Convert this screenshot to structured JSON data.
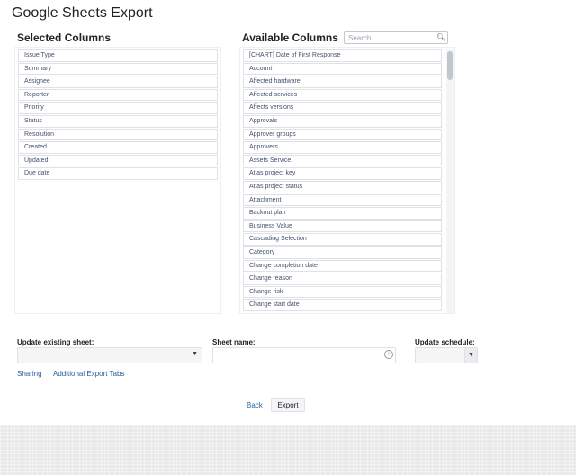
{
  "page": {
    "title": "Google Sheets Export"
  },
  "selected": {
    "heading": "Selected Columns",
    "items": [
      "Issue Type",
      "Summary",
      "Assignee",
      "Reporter",
      "Priority",
      "Status",
      "Resolution",
      "Created",
      "Updated",
      "Due date"
    ]
  },
  "available": {
    "heading": "Available Columns",
    "search_placeholder": "Search",
    "items": [
      "[CHART] Date of First Response",
      "Account",
      "Affected hardware",
      "Affected services",
      "Affects versions",
      "Approvals",
      "Approver groups",
      "Approvers",
      "Assets Service",
      "Atlas project key",
      "Atlas project status",
      "Attachment",
      "Backout plan",
      "Business Value",
      "Cascading Selection",
      "Category",
      "Change completion date",
      "Change reason",
      "Change risk",
      "Change start date"
    ]
  },
  "form": {
    "update_existing_label": "Update existing sheet:",
    "sheet_name_label": "Sheet name:",
    "update_schedule_label": "Update schedule:",
    "update_existing_value": "",
    "sheet_name_value": "",
    "update_schedule_value": ""
  },
  "links": {
    "sharing": "Sharing",
    "additional_tabs": "Additional Export Tabs"
  },
  "actions": {
    "back": "Back",
    "export": "Export"
  },
  "icons": {
    "search": "search-icon",
    "info": "info-icon",
    "dropdown": "chevron-down-icon"
  },
  "colors": {
    "link": "#2b5f9e",
    "border": "#dfe1e6",
    "item_text": "#42526e"
  }
}
